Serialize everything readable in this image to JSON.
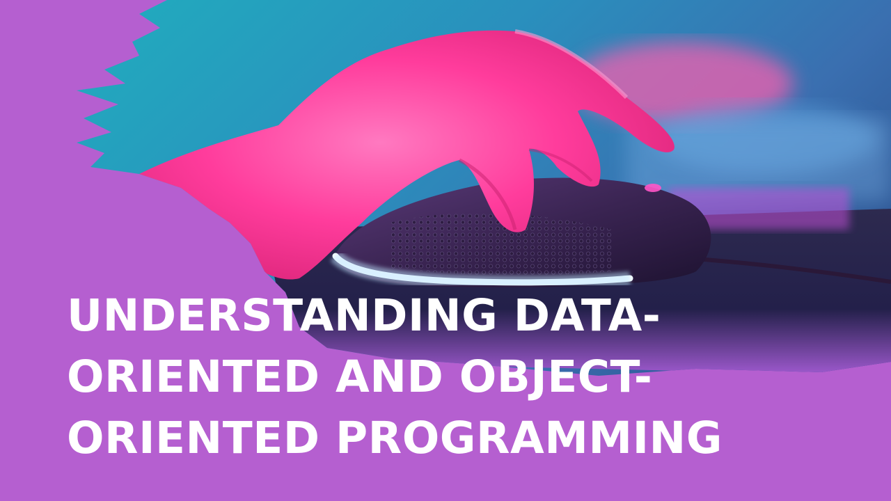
{
  "banner": {
    "headline_lines": [
      "UNDERSTANDING DATA-",
      "ORIENTED AND OBJECT-",
      "ORIENTED PROGRAMMING"
    ],
    "background_color": "#b55fd0",
    "photo": {
      "subject": "hand-on-gaming-mouse",
      "colors": {
        "teal": "#1aa7b8",
        "blue": "#2c7fb3",
        "pink": "#ff3d9a",
        "dark": "#2a1840",
        "glow": "#e8f6ff"
      }
    }
  }
}
